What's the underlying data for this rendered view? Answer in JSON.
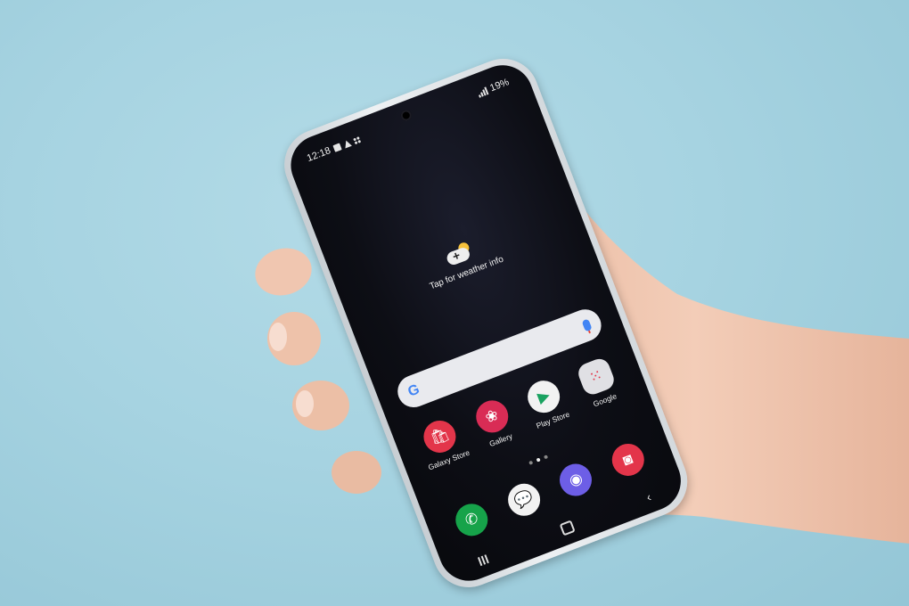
{
  "status_bar": {
    "time": "12:18",
    "battery": "19%"
  },
  "weather": {
    "text": "Tap for weather info",
    "icon": "weather-add-icon"
  },
  "search": {
    "logo": "G",
    "icons": [
      "google-logo-icon",
      "mic-icon"
    ]
  },
  "apps": [
    {
      "label": "Galaxy Store",
      "icon": "shopping-bag-icon",
      "color": "#e3354a",
      "glyph": "🛍"
    },
    {
      "label": "Gallery",
      "icon": "flower-icon",
      "color": "#d92c55",
      "glyph": "❀"
    },
    {
      "label": "Play Store",
      "icon": "play-triangle-icon",
      "color": "#f2f2f2",
      "glyph": "▶"
    },
    {
      "label": "Google",
      "icon": "app-folder-icon",
      "color": "#e0e0e4",
      "glyph": "⁙"
    }
  ],
  "dock": [
    {
      "icon": "phone-icon",
      "color": "#16a34a",
      "glyph": "✆"
    },
    {
      "icon": "messages-icon",
      "color": "#f2f2f2",
      "glyph": "💬"
    },
    {
      "icon": "internet-planet-icon",
      "color": "#6d5ee6",
      "glyph": "◉"
    },
    {
      "icon": "camera-icon",
      "color": "#e3354a",
      "glyph": "◙"
    }
  ],
  "nav": {
    "icons": [
      "recents-icon",
      "home-icon",
      "back-icon"
    ]
  },
  "colors": {
    "background": "#a6d3e1",
    "skin": "#efc7b0",
    "screen": "#0d0e15"
  }
}
